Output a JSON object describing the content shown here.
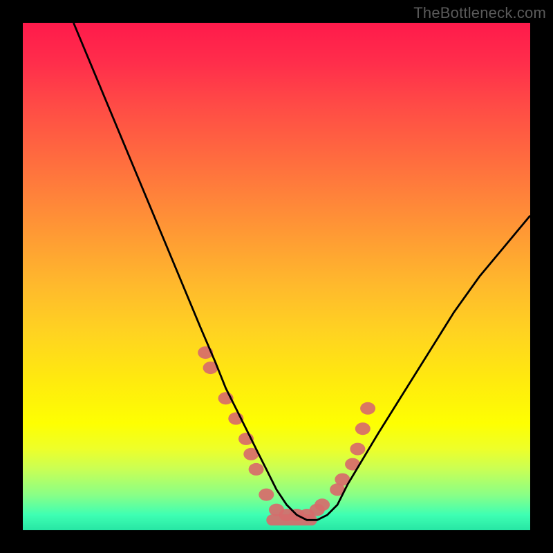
{
  "watermark": "TheBottleneck.com",
  "chart_data": {
    "type": "line",
    "title": "",
    "xlabel": "",
    "ylabel": "",
    "xlim": [
      0,
      100
    ],
    "ylim": [
      0,
      100
    ],
    "series": [
      {
        "name": "curve",
        "x": [
          10,
          15,
          20,
          25,
          30,
          35,
          38,
          40,
          42,
          44,
          46,
          48,
          50,
          52,
          54,
          56,
          58,
          60,
          62,
          64,
          70,
          75,
          80,
          85,
          90,
          95,
          100
        ],
        "values": [
          100,
          88,
          76,
          64,
          52,
          40,
          33,
          28,
          24,
          20,
          16,
          12,
          8,
          5,
          3,
          2,
          2,
          3,
          5,
          9,
          19,
          27,
          35,
          43,
          50,
          56,
          62
        ]
      }
    ],
    "scatter": {
      "name": "points",
      "color": "#d76b6b",
      "x": [
        36,
        37,
        40,
        42,
        44,
        45,
        46,
        48,
        50,
        52,
        54,
        56,
        58,
        59,
        62,
        63,
        65,
        66,
        67,
        68
      ],
      "values": [
        35,
        32,
        26,
        22,
        18,
        15,
        12,
        7,
        4,
        3,
        3,
        3,
        4,
        5,
        8,
        10,
        13,
        16,
        20,
        24
      ]
    }
  }
}
